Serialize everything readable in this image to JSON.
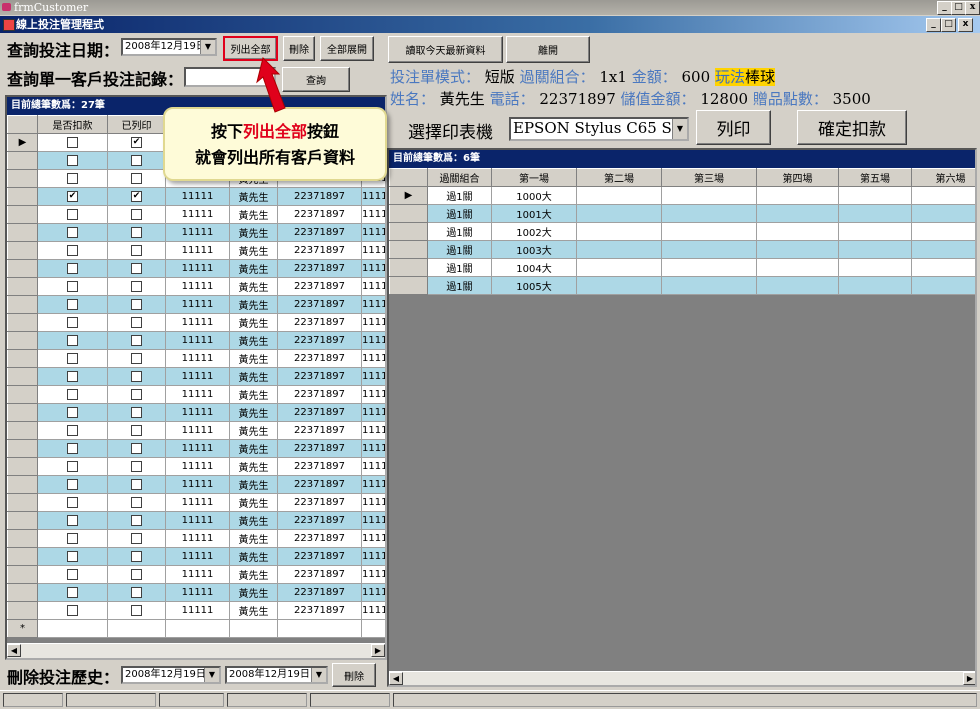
{
  "window": {
    "title": "frmCustomer",
    "mdi_title": "線上投注管理程式",
    "min": "_",
    "max": "□",
    "close": "x",
    "mdi_min": "_",
    "mdi_max": "□",
    "mdi_close": "x"
  },
  "query": {
    "date_label": "查詢投注日期：",
    "date_value": "2008年12月19日",
    "list_all": "列出全部",
    "delete": "刪除",
    "expand_all": "全部展開",
    "single_label": "查詢單一客戶投注記錄：",
    "single_value": "",
    "search": "查詢"
  },
  "top_buttons": {
    "read_today": "讀取今天最新資料",
    "leave": "離開"
  },
  "info": {
    "mode_label": "投注單模式：",
    "mode_value": "短版",
    "combo_label": "過關組合：",
    "combo_value": "1x1",
    "amount_label": "金額：",
    "amount_value": "600",
    "play_label": "玩法",
    "play_value": "棒球",
    "name_label": "姓名：",
    "name_value": "黃先生",
    "phone_label": "電話：",
    "phone_value": "22371897",
    "stored_label": "儲值金額：",
    "stored_value": "12800",
    "points_label": "贈品點數：",
    "points_value": "3500"
  },
  "printer": {
    "label": "選擇印表機",
    "value": "EPSON Stylus C65 Se",
    "print": "列印",
    "confirm": "確定扣款"
  },
  "callout": {
    "line1_a": "按下",
    "line1_b": "列出全部",
    "line1_c": "按鈕",
    "line2": "就會列出所有客戶資料"
  },
  "left_grid": {
    "caption": "目前總筆數爲：27筆",
    "headers": [
      "是否扣款",
      "已列印",
      "",
      "",
      "",
      ""
    ],
    "new_row_marker": "*",
    "rows": [
      {
        "paid": false,
        "printed": true,
        "id": "",
        "name": "",
        "phone": "",
        "extra": ""
      },
      {
        "paid": false,
        "printed": false,
        "id": "",
        "name": "",
        "phone": "",
        "extra": ""
      },
      {
        "paid": false,
        "printed": false,
        "id": "11111",
        "name": "黃先生",
        "phone": "22371897",
        "extra": "1111"
      },
      {
        "paid": true,
        "printed": true,
        "id": "11111",
        "name": "黃先生",
        "phone": "22371897",
        "extra": "1111"
      },
      {
        "paid": false,
        "printed": false,
        "id": "11111",
        "name": "黃先生",
        "phone": "22371897",
        "extra": "1111"
      },
      {
        "paid": false,
        "printed": false,
        "id": "11111",
        "name": "黃先生",
        "phone": "22371897",
        "extra": "1111"
      },
      {
        "paid": false,
        "printed": false,
        "id": "11111",
        "name": "黃先生",
        "phone": "22371897",
        "extra": "1111"
      },
      {
        "paid": false,
        "printed": false,
        "id": "11111",
        "name": "黃先生",
        "phone": "22371897",
        "extra": "1111"
      },
      {
        "paid": false,
        "printed": false,
        "id": "11111",
        "name": "黃先生",
        "phone": "22371897",
        "extra": "1111"
      },
      {
        "paid": false,
        "printed": false,
        "id": "11111",
        "name": "黃先生",
        "phone": "22371897",
        "extra": "1111"
      },
      {
        "paid": false,
        "printed": false,
        "id": "11111",
        "name": "黃先生",
        "phone": "22371897",
        "extra": "1111"
      },
      {
        "paid": false,
        "printed": false,
        "id": "11111",
        "name": "黃先生",
        "phone": "22371897",
        "extra": "1111"
      },
      {
        "paid": false,
        "printed": false,
        "id": "11111",
        "name": "黃先生",
        "phone": "22371897",
        "extra": "1111"
      },
      {
        "paid": false,
        "printed": false,
        "id": "11111",
        "name": "黃先生",
        "phone": "22371897",
        "extra": "1111"
      },
      {
        "paid": false,
        "printed": false,
        "id": "11111",
        "name": "黃先生",
        "phone": "22371897",
        "extra": "1111"
      },
      {
        "paid": false,
        "printed": false,
        "id": "11111",
        "name": "黃先生",
        "phone": "22371897",
        "extra": "1111"
      },
      {
        "paid": false,
        "printed": false,
        "id": "11111",
        "name": "黃先生",
        "phone": "22371897",
        "extra": "1111"
      },
      {
        "paid": false,
        "printed": false,
        "id": "11111",
        "name": "黃先生",
        "phone": "22371897",
        "extra": "1111"
      },
      {
        "paid": false,
        "printed": false,
        "id": "11111",
        "name": "黃先生",
        "phone": "22371897",
        "extra": "1111"
      },
      {
        "paid": false,
        "printed": false,
        "id": "11111",
        "name": "黃先生",
        "phone": "22371897",
        "extra": "1111"
      },
      {
        "paid": false,
        "printed": false,
        "id": "11111",
        "name": "黃先生",
        "phone": "22371897",
        "extra": "1111"
      },
      {
        "paid": false,
        "printed": false,
        "id": "11111",
        "name": "黃先生",
        "phone": "22371897",
        "extra": "1111"
      },
      {
        "paid": false,
        "printed": false,
        "id": "11111",
        "name": "黃先生",
        "phone": "22371897",
        "extra": "1111"
      },
      {
        "paid": false,
        "printed": false,
        "id": "11111",
        "name": "黃先生",
        "phone": "22371897",
        "extra": "1111"
      },
      {
        "paid": false,
        "printed": false,
        "id": "11111",
        "name": "黃先生",
        "phone": "22371897",
        "extra": "1111"
      },
      {
        "paid": false,
        "printed": false,
        "id": "11111",
        "name": "黃先生",
        "phone": "22371897",
        "extra": "1111"
      },
      {
        "paid": false,
        "printed": false,
        "id": "11111",
        "name": "黃先生",
        "phone": "22371897",
        "extra": "1111"
      }
    ]
  },
  "right_grid": {
    "caption": "目前總筆數爲：6筆",
    "headers": [
      "過關組合",
      "第一場",
      "第二場",
      "第三場",
      "第四場",
      "第五場",
      "第六場"
    ],
    "rows": [
      [
        "過1關",
        "1000大",
        "",
        "",
        "",
        "",
        ""
      ],
      [
        "過1關",
        "1001大",
        "",
        "",
        "",
        "",
        ""
      ],
      [
        "過1關",
        "1002大",
        "",
        "",
        "",
        "",
        ""
      ],
      [
        "過1關",
        "1003大",
        "",
        "",
        "",
        "",
        ""
      ],
      [
        "過1關",
        "1004大",
        "",
        "",
        "",
        "",
        ""
      ],
      [
        "過1關",
        "1005大",
        "",
        "",
        "",
        "",
        ""
      ]
    ]
  },
  "delete_history": {
    "label": "刪除投注歷史：",
    "from": "2008年12月19日",
    "to": "2008年12月19日",
    "delete": "刪除"
  },
  "colors": {
    "row_alt": "#add8e6",
    "caption_bg": "#0a246a",
    "highlight": "#ffd300",
    "callout_red": "#e0001b"
  }
}
